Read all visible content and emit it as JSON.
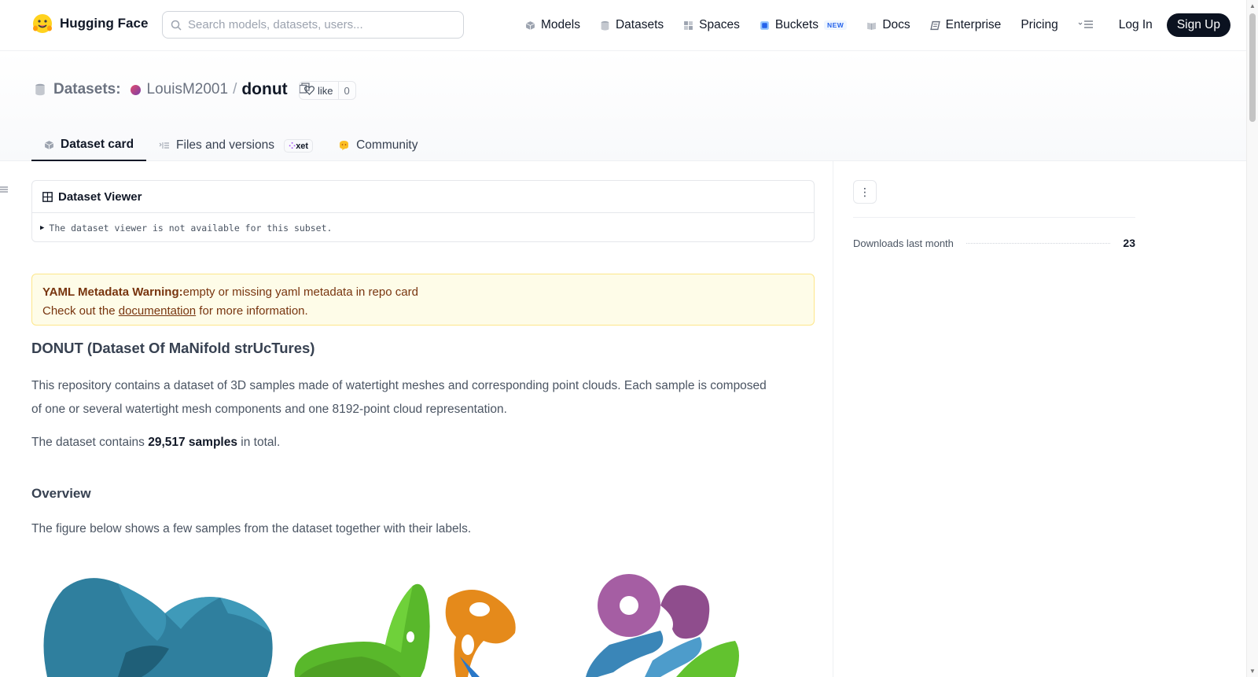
{
  "nav": {
    "brand": "Hugging Face",
    "search_placeholder": "Search models, datasets, users...",
    "items": [
      {
        "label": "Models",
        "icon": "cube-icon",
        "color": "#9ca3af"
      },
      {
        "label": "Datasets",
        "icon": "database-icon",
        "color": "#9ca3af"
      },
      {
        "label": "Spaces",
        "icon": "grid-icon",
        "color": "#9ca3af"
      },
      {
        "label": "Buckets",
        "icon": "bucket-icon",
        "color": "#2563eb",
        "badge": "NEW"
      },
      {
        "label": "Docs",
        "icon": "book-icon",
        "color": "#9ca3af"
      },
      {
        "label": "Enterprise",
        "icon": "enterprise-icon",
        "color": "#6b7280"
      },
      {
        "label": "Pricing"
      }
    ],
    "login": "Log In",
    "signup": "Sign Up"
  },
  "repo": {
    "type_label": "Datasets:",
    "owner": "LouisM2001",
    "separator": "/",
    "name": "donut",
    "like_label": "like",
    "like_count": "0"
  },
  "tabs": [
    {
      "label": "Dataset card",
      "icon": "cube-icon",
      "active": true
    },
    {
      "label": "Files and versions",
      "icon": "files-icon",
      "badge": "xet"
    },
    {
      "label": "Community",
      "icon": "community-icon"
    }
  ],
  "viewer": {
    "title": "Dataset Viewer",
    "message": "The dataset viewer is not available for this subset."
  },
  "warning": {
    "title": "YAML Metadata Warning:",
    "text": "empty or missing yaml metadata in repo card",
    "line2_prefix": "Check out the ",
    "link": "documentation",
    "line2_suffix": " for more information."
  },
  "card": {
    "title": "DONUT (Dataset Of MaNifold strUcTures)",
    "intro": "This repository contains a dataset of 3D samples made of watertight meshes and corresponding point clouds. Each sample is composed of one or several watertight mesh components and one 8192-point cloud representation.",
    "count_prefix": "The dataset contains ",
    "count_value": "29,517 samples",
    "count_suffix": " in total.",
    "overview_heading": "Overview",
    "overview_text": "The figure below shows a few samples from the dataset together with their labels."
  },
  "sidebar": {
    "downloads_label": "Downloads last month",
    "downloads_value": "23"
  }
}
